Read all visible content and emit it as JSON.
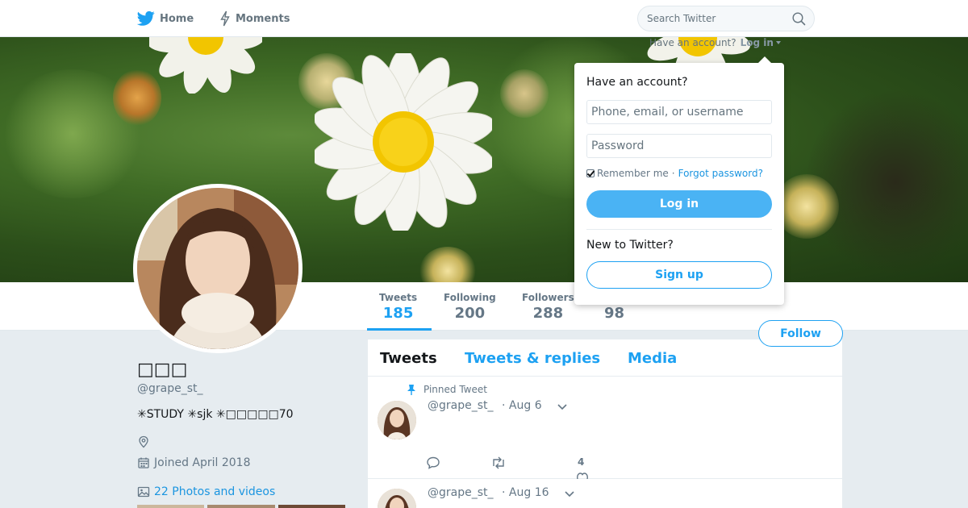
{
  "nav": {
    "home_label": "Home",
    "moments_label": "Moments",
    "search_placeholder": "Search Twitter"
  },
  "login_bar": {
    "prompt": "Have an account?",
    "login_label": "Log in"
  },
  "login_dropdown": {
    "title": "Have an account?",
    "username_placeholder": "Phone, email, or username",
    "password_placeholder": "Password",
    "remember_label": "Remember me",
    "separator": "·",
    "forgot_label": "Forgot password?",
    "login_button": "Log in",
    "new_prompt": "New to Twitter?",
    "signup_button": "Sign up"
  },
  "stats": [
    {
      "label": "Tweets",
      "value": "185"
    },
    {
      "label": "Following",
      "value": "200"
    },
    {
      "label": "Followers",
      "value": "288"
    },
    {
      "label": "",
      "value": "98"
    }
  ],
  "follow_button": "Follow",
  "profile": {
    "name": "□□□",
    "handle": "@grape_st_",
    "bio": "✳︎STUDY ✳︎sjk ✳︎□□□□□70",
    "location": "",
    "joined": "Joined April 2018",
    "photos_link": "22 Photos and videos"
  },
  "timeline": {
    "tabs": [
      "Tweets",
      "Tweets & replies",
      "Media"
    ],
    "tweets": [
      {
        "pinned_label": "Pinned Tweet",
        "handle": "@grape_st_",
        "date": "· Aug 6",
        "likes": "4"
      },
      {
        "handle": "@grape_st_",
        "date": "· Aug 16"
      }
    ]
  },
  "colors": {
    "accent": "#1da1f2",
    "login_button": "#4ab3f4",
    "link": "#1b95e0",
    "muted": "#657786"
  },
  "icons": [
    "twitter-bird-icon",
    "bolt-icon",
    "search-icon",
    "pin-icon",
    "location-icon",
    "calendar-icon",
    "photo-icon",
    "reply-icon",
    "retweet-icon",
    "like-icon",
    "chevron-down-icon"
  ]
}
